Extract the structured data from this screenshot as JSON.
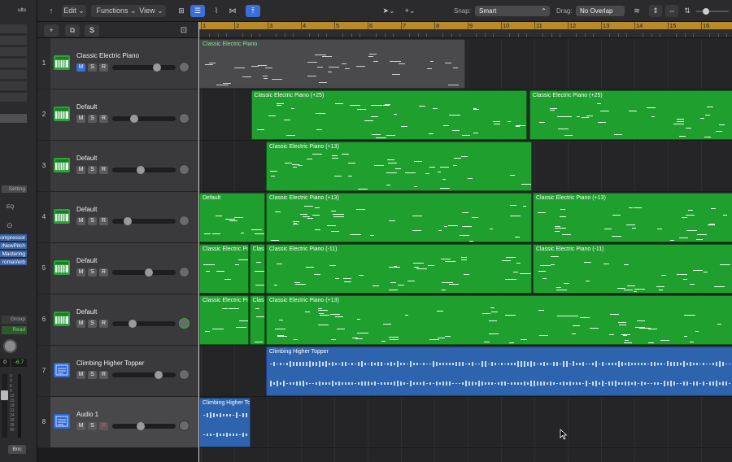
{
  "inspector": {
    "top_label": "ults",
    "setting_label": "Setting",
    "eq_label": "EQ",
    "plugins": [
      "ompressor",
      "lNewPitch",
      "Mastering",
      "romaVerb"
    ],
    "group_label": "Group",
    "read_label": "Read",
    "values": [
      "0",
      "-6.7"
    ],
    "bounce_label": "Bnc"
  },
  "toolbar": {
    "menus": [
      "Edit",
      "Functions",
      "View"
    ],
    "snap_label": "Snap:",
    "snap_value": "Smart",
    "drag_label": "Drag:",
    "drag_value": "No Overlap"
  },
  "header": {
    "add_symbol": "+",
    "s_label": "S"
  },
  "ruler": {
    "bars": [
      "1",
      "2",
      "3",
      "4",
      "5",
      "6",
      "7",
      "8",
      "9",
      "10",
      "11",
      "12",
      "13",
      "14",
      "15",
      "16"
    ]
  },
  "tracks": [
    {
      "number": "1",
      "name": "Classic Electric Piano",
      "type": "vintage-keys"
    },
    {
      "number": "2",
      "name": "Default",
      "type": "synth"
    },
    {
      "number": "3",
      "name": "Default",
      "type": "synth"
    },
    {
      "number": "4",
      "name": "Default",
      "type": "synth"
    },
    {
      "number": "5",
      "name": "Default",
      "type": "synth"
    },
    {
      "number": "6",
      "name": "Default",
      "type": "synth"
    },
    {
      "number": "7",
      "name": "Climbing Higher Topper",
      "type": "audio"
    },
    {
      "number": "8",
      "name": "Audio 1",
      "type": "audio"
    }
  ],
  "track_buttons": {
    "mute": "M",
    "solo": "S",
    "record": "R"
  },
  "regions": {
    "r1a": "Classic Electric Piano",
    "r2a": "Classic Electric Piano (+25)",
    "r2b": "Classic Electric Piano (+25)",
    "r3a": "Classic Electric Piano (+13)",
    "r4a": "Default",
    "r4b": "Classic Electric Piano (+13)",
    "r4c": "Classic Electric Piano (+13)",
    "r5a": "Classic Electric Pi",
    "r5b": "Class",
    "r5c": "Classic Electric Piano (-11)",
    "r5d": "Classic Electric Piano (-11)",
    "r6a": "Classic Electric Pi",
    "r6b": "Class",
    "r6c": "Classic Electric Piano (+13)",
    "r7a": "Climbing Higher Topper",
    "r8a": "Climbing Higher To"
  },
  "colors": {
    "midi_region": "#1f9f2e",
    "audio_region": "#2d64ad",
    "cycle": "#b88a2b",
    "selected_button": "#3a6fd8"
  }
}
